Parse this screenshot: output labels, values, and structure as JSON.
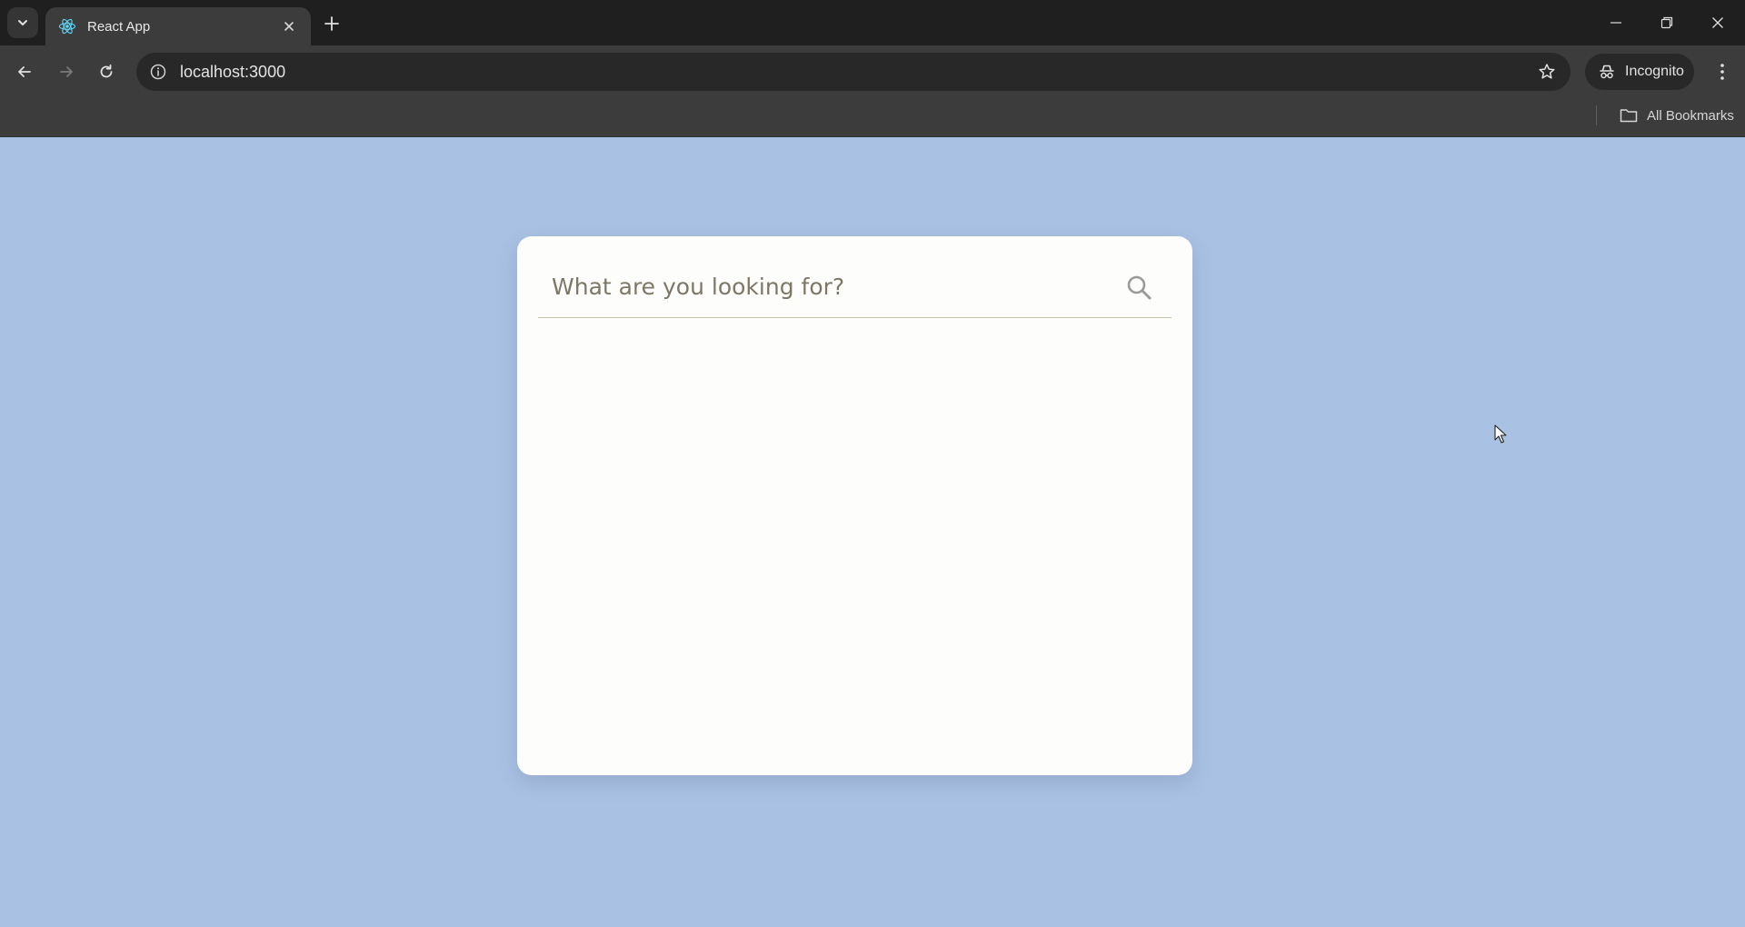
{
  "browser": {
    "tab": {
      "title": "React App",
      "favicon": "react-logo-icon"
    },
    "address_bar": {
      "url": "localhost:3000"
    },
    "profile_chip": {
      "label": "Incognito"
    },
    "bookmarks_bar": {
      "all_bookmarks_label": "All Bookmarks"
    }
  },
  "search": {
    "placeholder": "What are you looking for?",
    "value": "",
    "icon": "search-icon"
  },
  "colors": {
    "page_background": "#a9c1e2",
    "card_background": "#fdfdfc",
    "chrome_dark": "#1f1f1f",
    "chrome_toolbar": "#3c3c3c",
    "react_accent": "#61dafb"
  }
}
